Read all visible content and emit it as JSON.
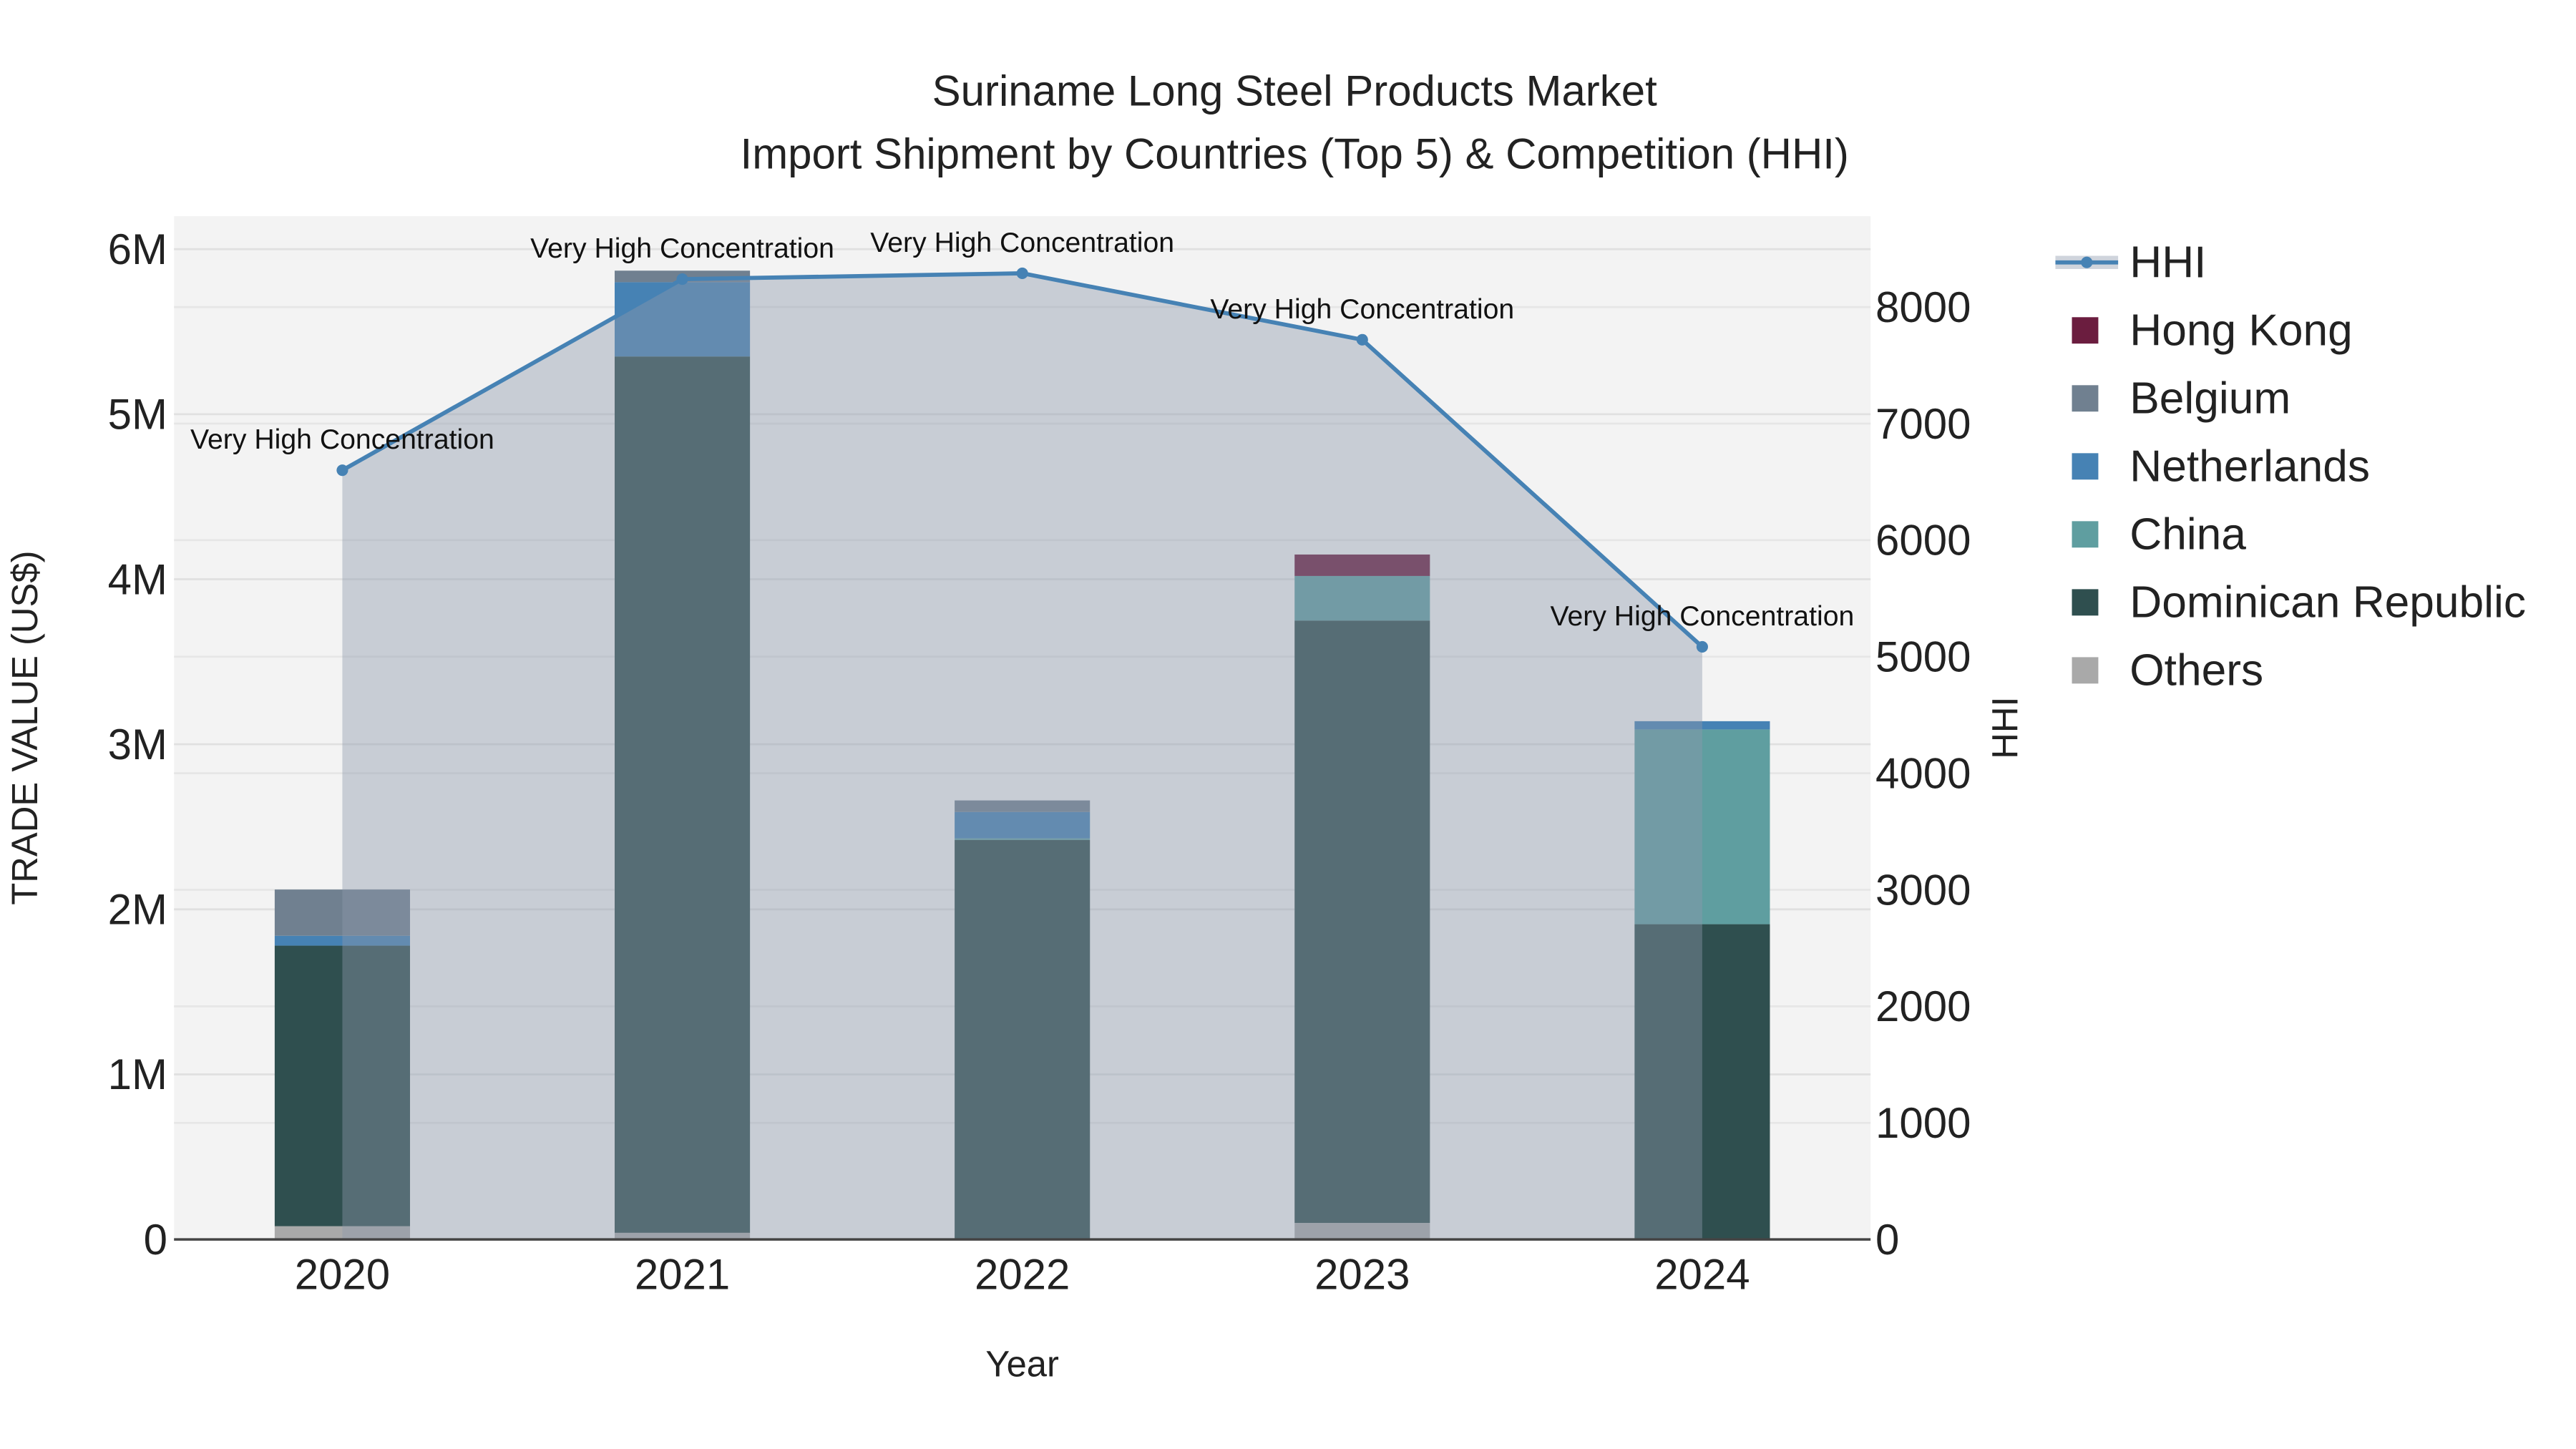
{
  "chart_data": {
    "type": "bar",
    "title_line1": "Suriname Long Steel Products Market",
    "title_line2": "Import Shipment by Countries (Top 5) & Competition (HHI)",
    "xlabel": "Year",
    "ylabel": "TRADE VALUE (US$)",
    "y2label": "HHI",
    "categories": [
      "2020",
      "2021",
      "2022",
      "2023",
      "2024"
    ],
    "ylim": [
      0,
      6200000
    ],
    "y_ticks": [
      {
        "v": 0,
        "label": "0"
      },
      {
        "v": 1000000,
        "label": "1M"
      },
      {
        "v": 2000000,
        "label": "2M"
      },
      {
        "v": 3000000,
        "label": "3M"
      },
      {
        "v": 4000000,
        "label": "4M"
      },
      {
        "v": 5000000,
        "label": "5M"
      },
      {
        "v": 6000000,
        "label": "6M"
      }
    ],
    "y2lim": [
      0,
      8780
    ],
    "y2_ticks": [
      "0",
      "1000",
      "2000",
      "3000",
      "4000",
      "5000",
      "6000",
      "7000",
      "8000"
    ],
    "series": [
      {
        "name": "Others",
        "color": "#a9a9a9",
        "values": [
          80000,
          40000,
          0,
          100000,
          0
        ]
      },
      {
        "name": "Dominican Republic",
        "color": "#2f4f4f",
        "values": [
          1700000,
          5310000,
          2420000,
          3650000,
          1910000
        ]
      },
      {
        "name": "China",
        "color": "#5f9ea0",
        "values": [
          0,
          0,
          10000,
          270000,
          1180000
        ]
      },
      {
        "name": "Netherlands",
        "color": "#4682b4",
        "values": [
          60000,
          450000,
          160000,
          0,
          50000
        ]
      },
      {
        "name": "Belgium",
        "color": "#708090",
        "values": [
          280000,
          70000,
          70000,
          0,
          0
        ]
      },
      {
        "name": "Hong Kong",
        "color": "#6b1d3f",
        "values": [
          0,
          0,
          0,
          130000,
          0
        ]
      }
    ],
    "hhi": {
      "name": "HHI",
      "color": "#4682b4",
      "values": [
        6600,
        8240,
        8290,
        7720,
        5085
      ],
      "annotations": [
        "Very High Concentration",
        "Very High Concentration",
        "Very High Concentration",
        "Very High Concentration",
        "Very High Concentration"
      ]
    },
    "legend": [
      "HHI",
      "Hong Kong",
      "Belgium",
      "Netherlands",
      "China",
      "Dominican Republic",
      "Others"
    ],
    "legend_position": "right"
  }
}
